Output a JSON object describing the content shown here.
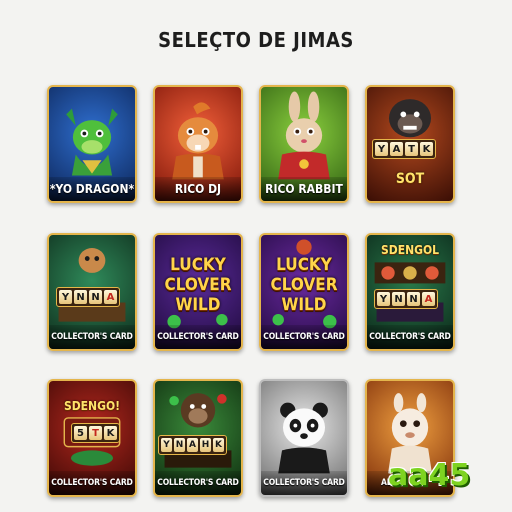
{
  "page": {
    "title": "SELEÇTO DE JIMAS"
  },
  "cards": [
    {
      "label": "*YO DRAGON*",
      "icon": "dragon-icon"
    },
    {
      "label": "RICO DJ",
      "icon": "hamster-dj-icon"
    },
    {
      "label": "RICO RABBIT",
      "icon": "rabbit-icon"
    },
    {
      "label": "",
      "icon": "gorilla-icon",
      "reel": [
        "Y",
        "A",
        "T",
        "K"
      ],
      "sign": "SOT"
    },
    {
      "label": "COLLECTOR'S CARD",
      "icon": "slot-machine-icon",
      "reel": [
        "Y",
        "N",
        "N",
        "A"
      ]
    },
    {
      "label": "COLLECTOR'S CARD",
      "icon": "clover-icon",
      "lucky": [
        "LUCKY",
        "CLOVER",
        "WILD"
      ]
    },
    {
      "label": "COLLECTOR'S CARD",
      "icon": "clover-icon",
      "lucky": [
        "LUCKY",
        "CLOVER",
        "WILD"
      ]
    },
    {
      "label": "COLLECTOR'S CARD",
      "icon": "slot-machine-icon",
      "sign": "SDENGOL",
      "reel": [
        "Y",
        "N",
        "N",
        "A"
      ]
    },
    {
      "label": "COLLECTOR'S CARD",
      "icon": "slot-machine-icon",
      "sign": "SDENGO!",
      "reel": [
        "5",
        "T",
        "K"
      ]
    },
    {
      "label": "COLLECTOR'S CARD",
      "icon": "gorilla-icon",
      "reel": [
        "Y",
        "N",
        "A",
        "H",
        "K"
      ]
    },
    {
      "label": "COLLECTOR'S CARD",
      "icon": "panda-icon"
    },
    {
      "label": "AL",
      "icon": "alpaca-icon"
    }
  ],
  "watermark": {
    "text": "aa45"
  }
}
